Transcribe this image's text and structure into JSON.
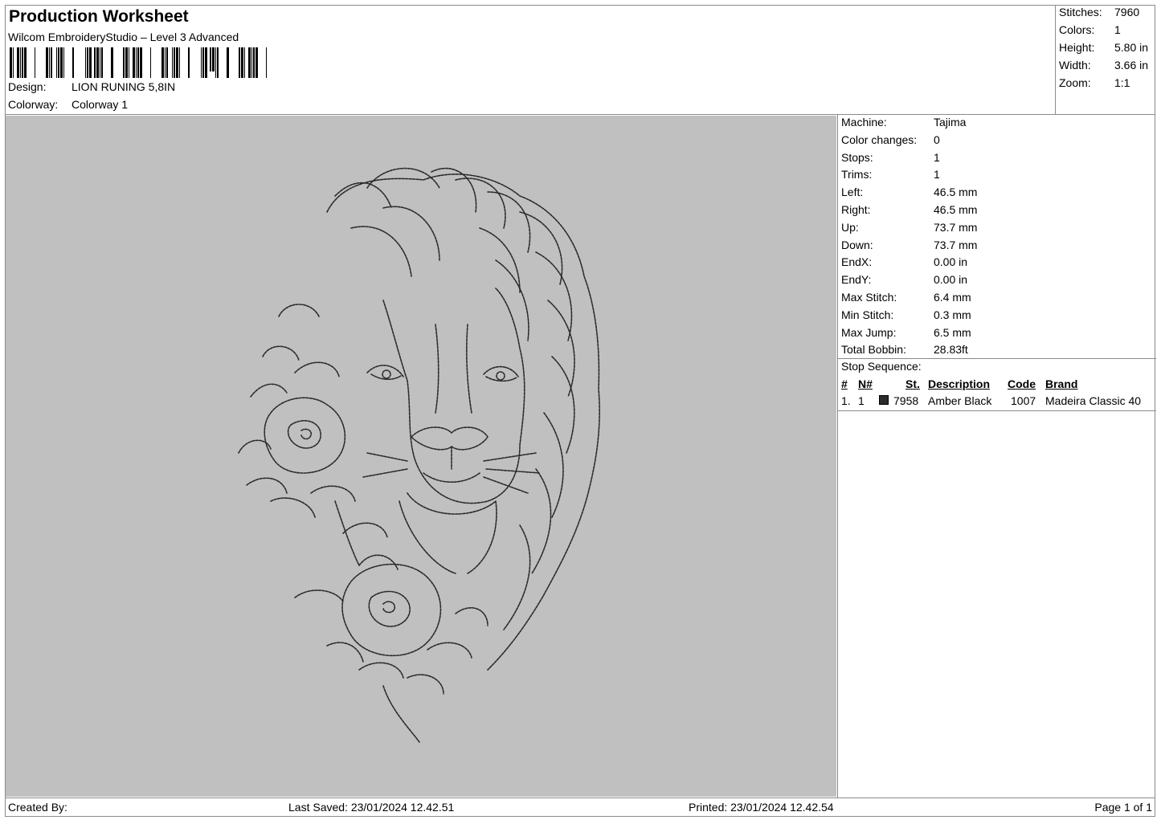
{
  "header": {
    "title": "Production Worksheet",
    "software": "Wilcom EmbroideryStudio – Level 3 Advanced",
    "design_label": "Design:",
    "design_value": "LION RUNING 5,8IN",
    "colorway_label": "Colorway:",
    "colorway_value": "Colorway 1"
  },
  "summary": {
    "stitches_label": "Stitches:",
    "stitches": "7960",
    "colors_label": "Colors:",
    "colors": "1",
    "height_label": "Height:",
    "height": "5.80 in",
    "width_label": "Width:",
    "width": "3.66 in",
    "zoom_label": "Zoom:",
    "zoom": "1:1"
  },
  "machine_info": [
    {
      "label": "Machine:",
      "value": "Tajima"
    },
    {
      "label": "Color changes:",
      "value": "0"
    },
    {
      "label": "Stops:",
      "value": "1"
    },
    {
      "label": "Trims:",
      "value": "1"
    },
    {
      "label": "Left:",
      "value": "46.5 mm"
    },
    {
      "label": "Right:",
      "value": "46.5 mm"
    },
    {
      "label": "Up:",
      "value": "73.7 mm"
    },
    {
      "label": "Down:",
      "value": "73.7 mm"
    },
    {
      "label": "EndX:",
      "value": "0.00 in"
    },
    {
      "label": "EndY:",
      "value": "0.00 in"
    },
    {
      "label": "Max Stitch:",
      "value": "6.4 mm"
    },
    {
      "label": "Min Stitch:",
      "value": "0.3 mm"
    },
    {
      "label": "Max Jump:",
      "value": "6.5 mm"
    },
    {
      "label": "Total Bobbin:",
      "value": "28.83ft"
    }
  ],
  "stop_sequence": {
    "title": "Stop Sequence:",
    "headers": {
      "num": "#",
      "n": "N#",
      "st": "St.",
      "description": "Description",
      "code": "Code",
      "brand": "Brand"
    },
    "rows": [
      {
        "num": "1.",
        "n": "1",
        "st": "7958",
        "description": "Amber Black",
        "code": "1007",
        "brand": "Madeira Classic 40",
        "color": "#2b2b2b"
      }
    ]
  },
  "footer": {
    "created_by": "Created By:",
    "last_saved": "Last Saved: 23/01/2024 12.42.51",
    "printed": "Printed: 23/01/2024 12.42.54",
    "page": "Page 1 of 1"
  },
  "colors": {
    "preview_bg": "#c0c0c0",
    "stitch": "#2b2b2b",
    "border": "#8a8a8a"
  }
}
